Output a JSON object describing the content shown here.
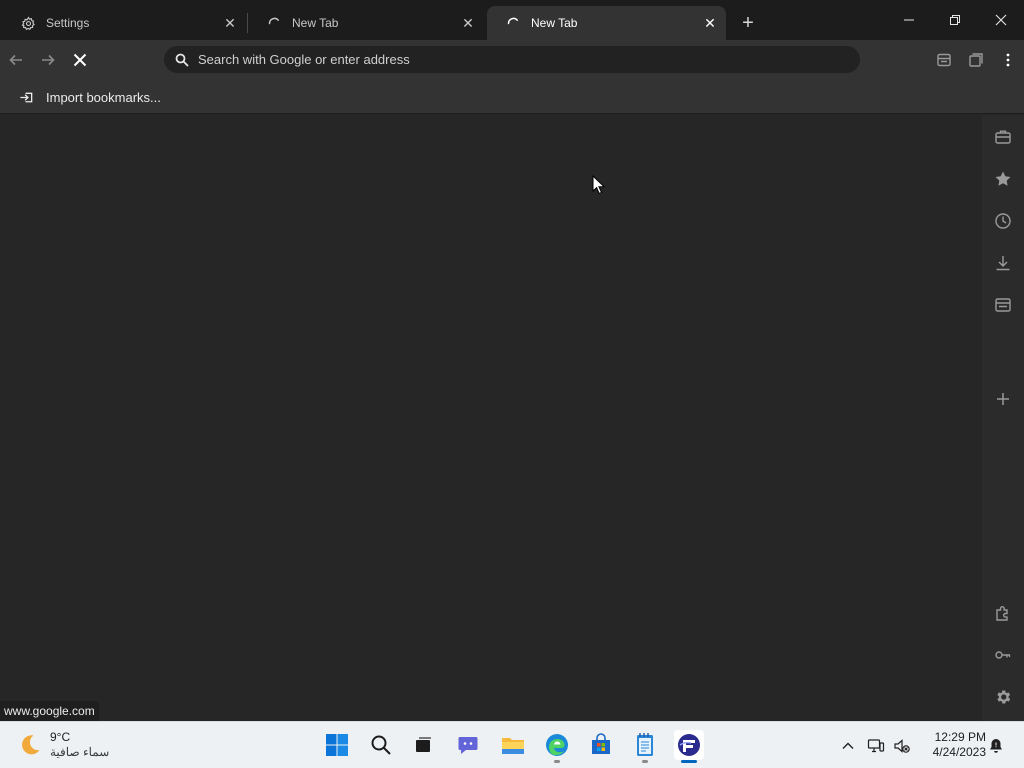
{
  "window": {
    "tabs": [
      {
        "title": "Settings",
        "icon": "gear-icon",
        "active": false
      },
      {
        "title": "New Tab",
        "icon": "loading-spinner-icon",
        "active": false
      },
      {
        "title": "New Tab",
        "icon": "loading-spinner-icon",
        "active": true
      }
    ],
    "new_tab_icon": "plus-icon",
    "controls": [
      "minimize-icon",
      "restore-icon",
      "close-icon"
    ]
  },
  "toolbar": {
    "back_icon": "arrow-left-icon",
    "forward_icon": "arrow-right-icon",
    "stop_icon": "stop-loading-icon",
    "address_placeholder": "Search with Google or enter address",
    "address_value": "",
    "right_icons": [
      "tab-actions-icon",
      "collections-icon",
      "more-menu-icon"
    ]
  },
  "bookmarks_bar": {
    "import_label": "Import bookmarks..."
  },
  "status_bar": {
    "url": "www.google.com"
  },
  "sidebar": {
    "items": [
      "briefcase-icon",
      "star-icon",
      "history-icon",
      "download-icon",
      "wallet-icon",
      "plus-icon",
      "extensions-icon",
      "key-icon",
      "settings-gear-icon"
    ]
  },
  "taskbar": {
    "weather": {
      "temperature": "9°C",
      "condition": "سماء صافية"
    },
    "apps": [
      "windows-start-icon",
      "search-icon",
      "task-view-icon",
      "chat-icon",
      "file-explorer-icon",
      "edge-icon",
      "store-icon",
      "notepad-icon",
      "browser-app-icon"
    ],
    "clock": {
      "time": "12:29 PM",
      "date": "4/24/2023"
    }
  },
  "colors": {
    "tab_strip": "#1c1c1c",
    "toolbar": "#333333",
    "content": "#262626",
    "sidebar": "#2b2b2b",
    "taskbar": "#eef1f4",
    "accent": "#0067c0"
  }
}
